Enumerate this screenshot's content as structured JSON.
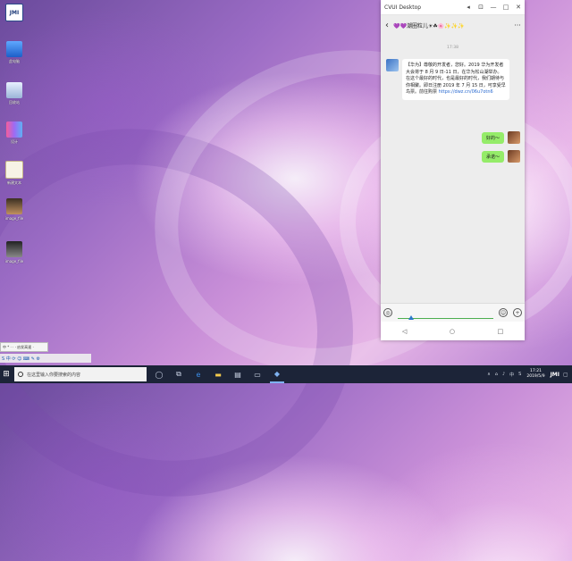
{
  "window": {
    "title": "CVUI Desktop",
    "controls": [
      "◂",
      "⊡",
      "—",
      "□",
      "✕"
    ]
  },
  "chat": {
    "group_name": "💜💜潮圈粒儿☀☘🌸✨✨✨",
    "timestamp": "17:38",
    "incoming": {
      "text": "【华为】尊敬的开发者，您好。2019 华为开发者大会将于 8 月 9 日-11 日，在华为松山湖举办。在这个最好的时代，也是最好的时代，我们期待与你相聚。即日注册 2019 年 7 月 15 日，可享受早鸟票。前往购票",
      "url": "https://dwz.cn/06u7otn6"
    },
    "outgoing": [
      {
        "text": "好的～"
      },
      {
        "text": "承诺～"
      }
    ]
  },
  "input": {
    "left_icon": "◎",
    "emoji_icon": "☺",
    "plus_icon": "+"
  },
  "nav": {
    "back": "◁",
    "home": "○",
    "recent": "□"
  },
  "desktop": {
    "logo_text": "JMI",
    "icons": [
      {
        "label": "此电脑"
      },
      {
        "label": "回收站"
      },
      {
        "label": "设计"
      },
      {
        "label": "新建文本"
      },
      {
        "label": "image_file"
      },
      {
        "label": "image_file"
      }
    ]
  },
  "float_toolbar": {
    "label": "中 * · ·  · 启发高速 ·"
  },
  "ime": {
    "label": "S 中 ⟳ ☺ ⌨ ✎ ⚙"
  },
  "taskbar": {
    "search_text": "在这里输入你要搜索的内容",
    "time": "17:21",
    "date": "2019/5/9",
    "brand": "JMI"
  }
}
